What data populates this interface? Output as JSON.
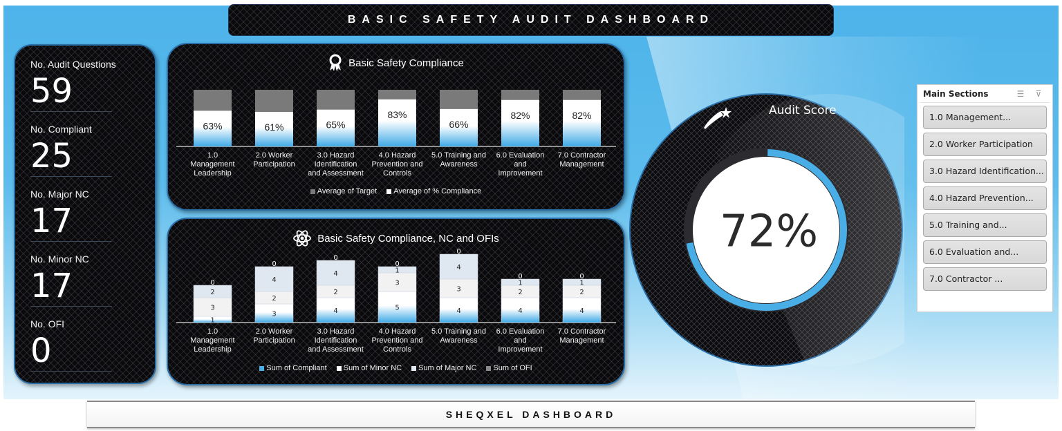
{
  "header": {
    "title": "BASIC SAFETY AUDIT DASHBOARD"
  },
  "footer": {
    "title": "SHEQXEL DASHBOARD"
  },
  "kpis": [
    {
      "label": "No. Audit Questions",
      "value": "59"
    },
    {
      "label": "No. Compliant",
      "value": "25"
    },
    {
      "label": "No. Major NC",
      "value": "17"
    },
    {
      "label": "No. Minor NC",
      "value": "17"
    },
    {
      "label": "No. OFI",
      "value": "0"
    }
  ],
  "gauge": {
    "title": "Audit Score",
    "value_label": "72%",
    "value": 72,
    "icon": "shooting-star-icon",
    "color": "#4aaee6"
  },
  "slicer": {
    "title": "Main Sections",
    "icons": [
      "multi-select-icon",
      "clear-filter-icon"
    ],
    "items": [
      "1.0 Management...",
      "2.0 Worker Participation",
      "3.0 Hazard Identification...",
      "4.0 Hazard Prevention...",
      "5.0 Training and...",
      "6.0 Evaluation and...",
      "7.0 Contractor ..."
    ]
  },
  "colors": {
    "accent": "#4aaee6",
    "target": "#7a7a7a",
    "major": "#dfe7f1",
    "minor": "#f2f2f2"
  },
  "chart_data": [
    {
      "type": "bar",
      "title": "Basic Safety Compliance",
      "icon": "award-ribbon-icon",
      "categories": [
        [
          "1.0",
          "Management",
          "Leadership"
        ],
        [
          "2.0 Worker",
          "Participation"
        ],
        [
          "3.0 Hazard",
          "Identification",
          "and Assessment"
        ],
        [
          "4.0 Hazard",
          "Prevention and",
          "Controls"
        ],
        [
          "5.0 Training and",
          "Awareness"
        ],
        [
          "6.0 Evaluation",
          "and",
          "Improvement"
        ],
        [
          "7.0 Contractor",
          "Management"
        ]
      ],
      "series": [
        {
          "name": "Average of Target",
          "values": [
            100,
            100,
            100,
            100,
            100,
            100,
            100
          ]
        },
        {
          "name": "Average of % Compliance",
          "values": [
            63,
            61,
            65,
            83,
            66,
            82,
            82
          ],
          "labels": [
            "63%",
            "61%",
            "65%",
            "83%",
            "66%",
            "82%",
            "82%"
          ]
        }
      ],
      "legend": "bottom",
      "ylim": [
        0,
        100
      ],
      "grid": false
    },
    {
      "type": "bar",
      "stacked": true,
      "title": "Basic Safety Compliance, NC and OFIs",
      "icon": "atom-icon",
      "categories": [
        [
          "1.0",
          "Management",
          "Leadership"
        ],
        [
          "2.0 Worker",
          "Participation"
        ],
        [
          "3.0 Hazard",
          "Identification",
          "and Assessment"
        ],
        [
          "4.0 Hazard",
          "Prevention and",
          "Controls"
        ],
        [
          "5.0 Training and",
          "Awareness"
        ],
        [
          "6.0 Evaluation",
          "and",
          "Improvement"
        ],
        [
          "7.0 Contractor",
          "Management"
        ]
      ],
      "series": [
        {
          "name": "Sum of Compliant",
          "values": [
            1,
            3,
            4,
            5,
            4,
            4,
            4
          ]
        },
        {
          "name": "Sum of Minor NC",
          "values": [
            3,
            2,
            2,
            3,
            3,
            2,
            2
          ]
        },
        {
          "name": "Sum of Major NC",
          "values": [
            2,
            4,
            4,
            1,
            4,
            1,
            1
          ]
        },
        {
          "name": "Sum of OFI",
          "values": [
            0,
            0,
            0,
            0,
            0,
            0,
            0
          ]
        }
      ],
      "legend": "bottom",
      "ylim": [
        0,
        12
      ],
      "grid": false
    }
  ]
}
